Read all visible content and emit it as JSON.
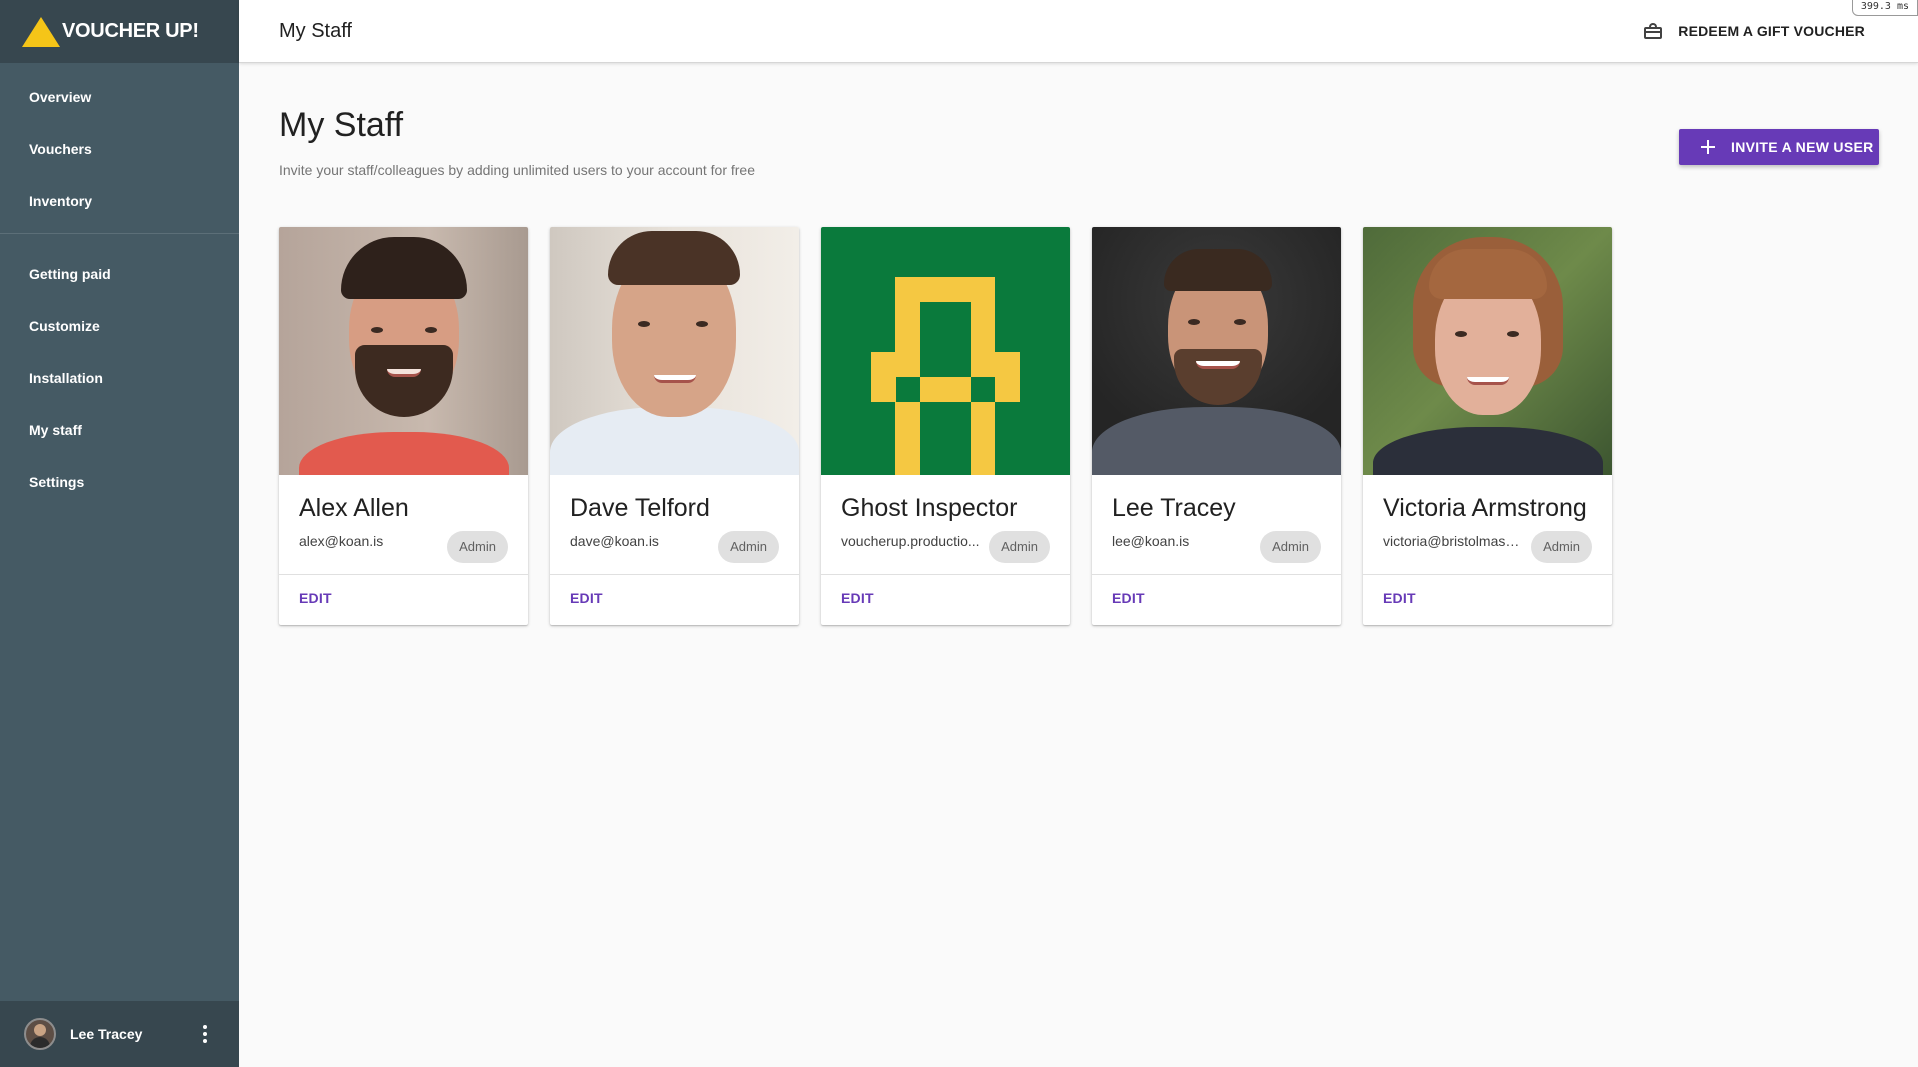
{
  "app": {
    "brand_name": "VOUCHER UP!",
    "brand_color": "#f5c518"
  },
  "sidebar": {
    "primary_items": [
      {
        "label": "Overview"
      },
      {
        "label": "Vouchers"
      },
      {
        "label": "Inventory"
      }
    ],
    "secondary_items": [
      {
        "label": "Getting paid"
      },
      {
        "label": "Customize"
      },
      {
        "label": "Installation"
      },
      {
        "label": "My staff"
      },
      {
        "label": "Settings"
      }
    ],
    "user": {
      "name": "Lee Tracey",
      "menu_icon": "more-vert-icon"
    },
    "background": "#455a64"
  },
  "header": {
    "title": "My Staff",
    "redeem_label": "REDEEM A GIFT VOUCHER",
    "redeem_icon": "gift-card-icon",
    "perf_badge": "399.3 ms"
  },
  "main": {
    "title": "My Staff",
    "subtitle": "Invite your staff/colleagues by adding unlimited users to your account for free",
    "invite_button": {
      "label": "INVITE A NEW USER",
      "icon": "plus-icon",
      "color": "#673ab7"
    },
    "staff": [
      {
        "name": "Alex Allen",
        "email": "alex@koan.is",
        "role": "Admin",
        "edit_label": "EDIT"
      },
      {
        "name": "Dave Telford",
        "email": "dave@koan.is",
        "role": "Admin",
        "edit_label": "EDIT"
      },
      {
        "name": "Ghost Inspector",
        "email": "voucherup.productio...",
        "role": "Admin",
        "edit_label": "EDIT"
      },
      {
        "name": "Lee Tracey",
        "email": "lee@koan.is",
        "role": "Admin",
        "edit_label": "EDIT"
      },
      {
        "name": "Victoria Armstrong",
        "email": "victoria@bristolmass...",
        "role": "Admin",
        "edit_label": "EDIT"
      }
    ]
  }
}
